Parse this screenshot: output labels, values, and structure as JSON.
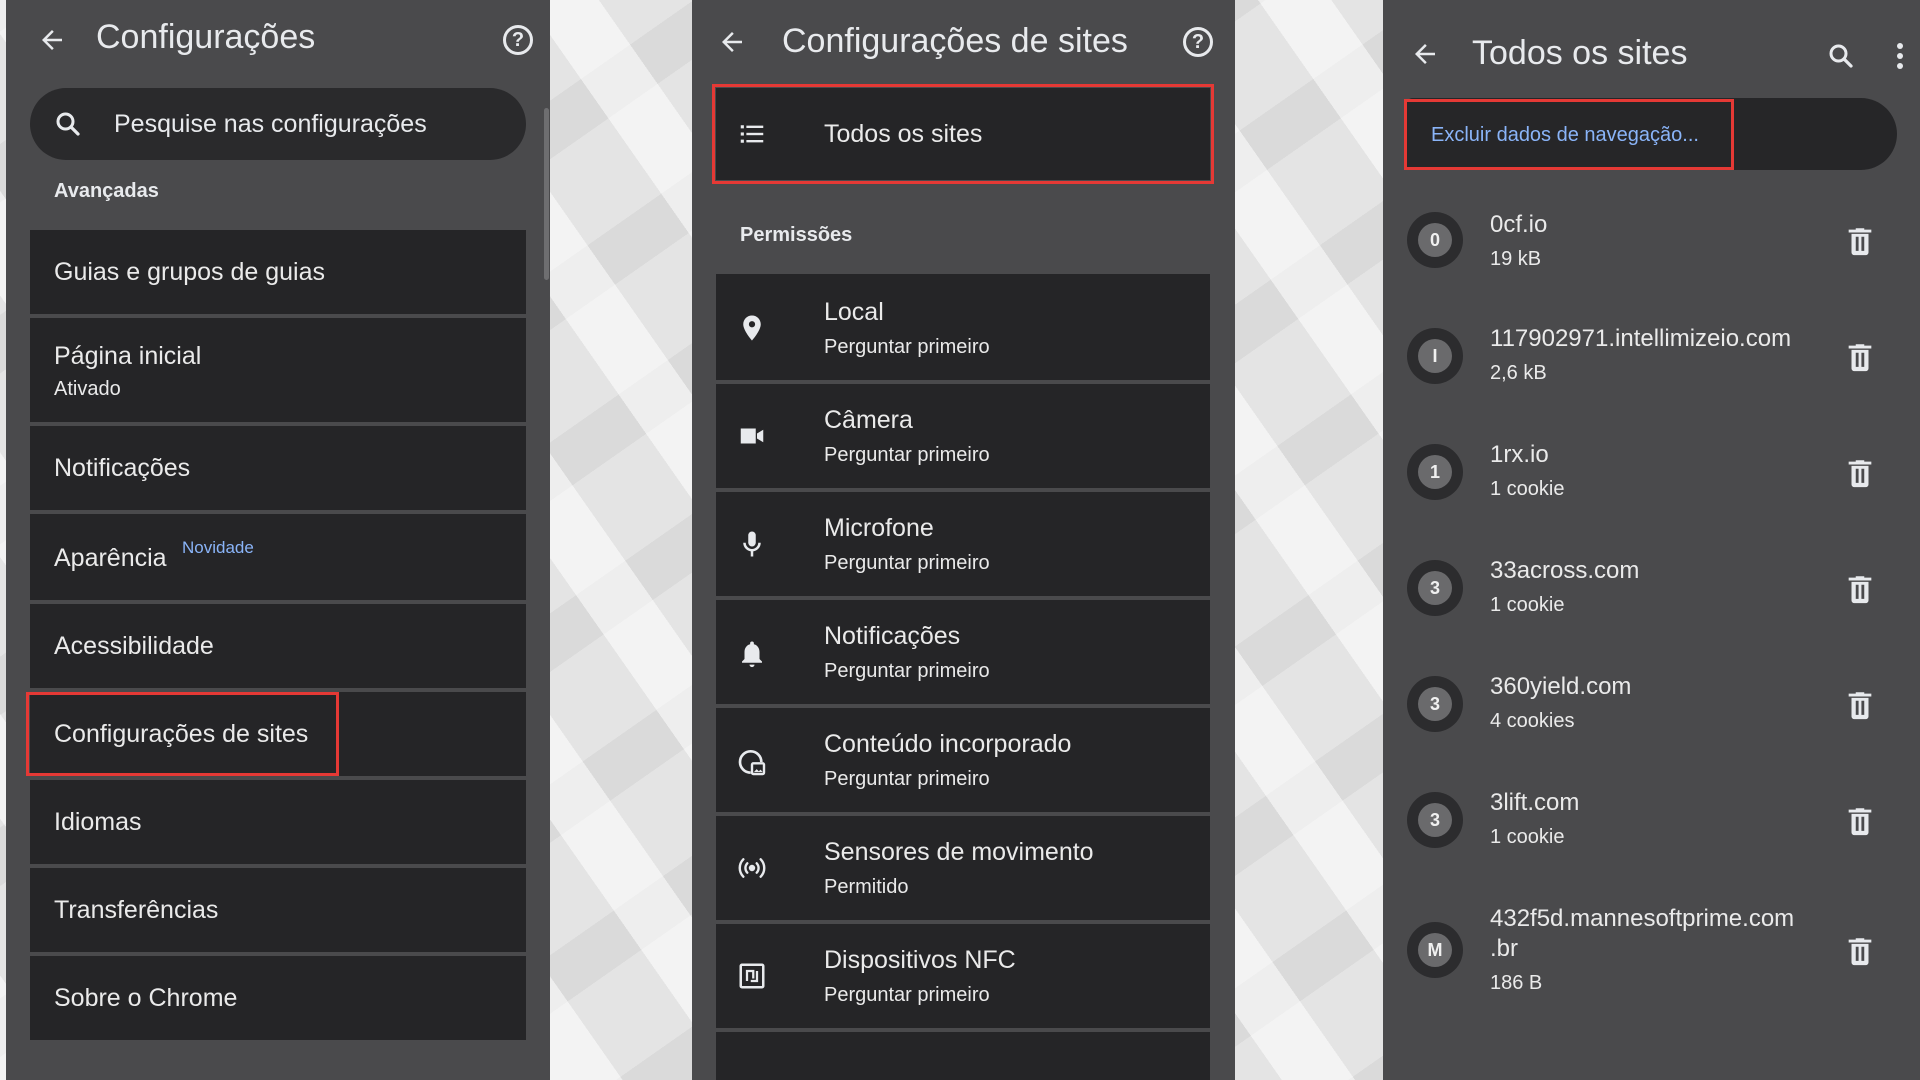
{
  "panel1": {
    "title": "Configurações",
    "search_placeholder": "Pesquise nas configurações",
    "section": "Avançadas",
    "items": [
      {
        "label": "Guias e grupos de guias"
      },
      {
        "label": "Página inicial",
        "sub": "Ativado"
      },
      {
        "label": "Notificações"
      },
      {
        "label": "Aparência",
        "badge": "Novidade"
      },
      {
        "label": "Acessibilidade"
      },
      {
        "label": "Configurações de sites"
      },
      {
        "label": "Idiomas"
      },
      {
        "label": "Transferências"
      },
      {
        "label": "Sobre o Chrome"
      }
    ]
  },
  "panel2": {
    "title": "Configurações de sites",
    "all_sites": "Todos os sites",
    "section": "Permissões",
    "items": [
      {
        "label": "Local",
        "sub": "Perguntar primeiro",
        "icon": "location-pin-icon"
      },
      {
        "label": "Câmera",
        "sub": "Perguntar primeiro",
        "icon": "camera-icon"
      },
      {
        "label": "Microfone",
        "sub": "Perguntar primeiro",
        "icon": "microphone-icon"
      },
      {
        "label": "Notificações",
        "sub": "Perguntar primeiro",
        "icon": "bell-icon"
      },
      {
        "label": "Conteúdo incorporado",
        "sub": "Perguntar primeiro",
        "icon": "embedded-content-icon"
      },
      {
        "label": "Sensores de movimento",
        "sub": "Permitido",
        "icon": "motion-sensors-icon"
      },
      {
        "label": "Dispositivos NFC",
        "sub": "Perguntar primeiro",
        "icon": "nfc-icon"
      }
    ]
  },
  "panel3": {
    "title": "Todos os sites",
    "clear_data": "Excluir dados de navegação...",
    "sites": [
      {
        "avatar": "0",
        "name": "0cf.io",
        "size": "19 kB"
      },
      {
        "avatar": "I",
        "name": "117902971.intellimizeio.com",
        "size": "2,6 kB"
      },
      {
        "avatar": "1",
        "name": "1rx.io",
        "size": "1 cookie"
      },
      {
        "avatar": "3",
        "name": "33across.com",
        "size": "1 cookie"
      },
      {
        "avatar": "3",
        "name": "360yield.com",
        "size": "4 cookies"
      },
      {
        "avatar": "3",
        "name": "3lift.com",
        "size": "1 cookie"
      },
      {
        "avatar": "M",
        "name": "432f5d.mannesoftprime.com",
        "name2": ".br",
        "size": "186 B"
      }
    ]
  },
  "colors": {
    "panel_bg": "#4a4a4c",
    "card_bg": "#252527",
    "link_blue": "#8ab4f8",
    "highlight_red": "#e53935"
  }
}
